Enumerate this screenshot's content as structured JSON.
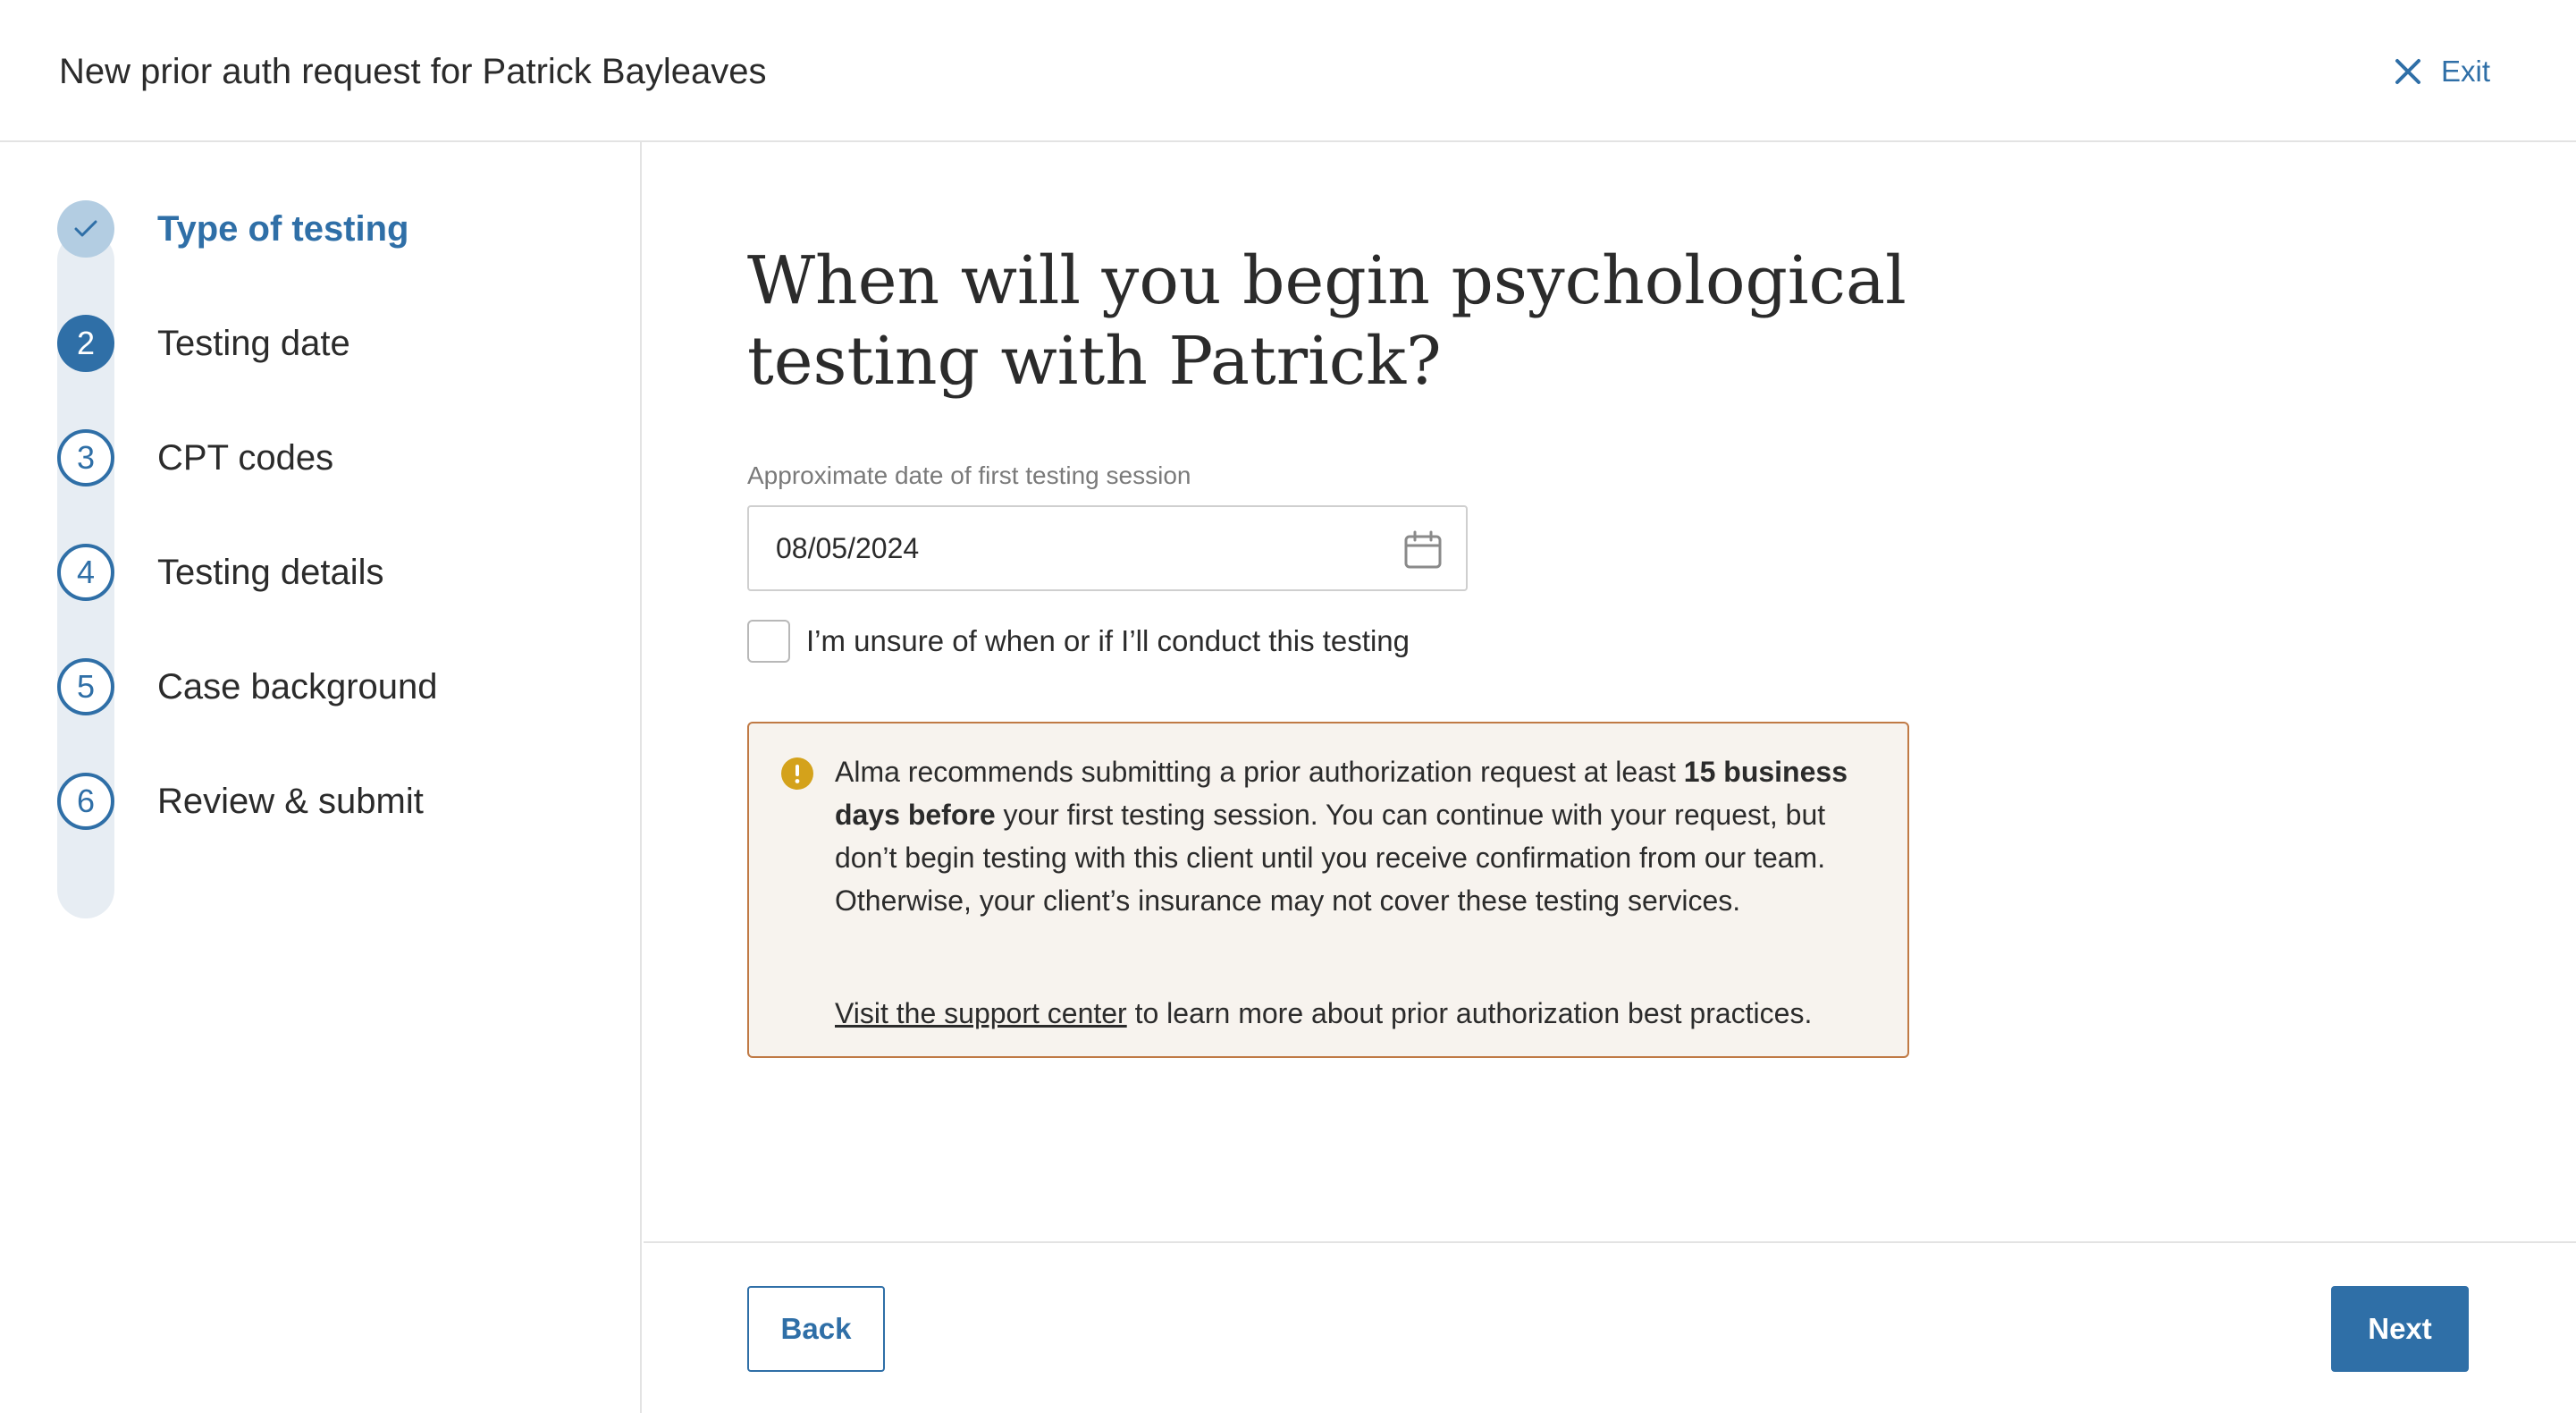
{
  "header": {
    "title": "New prior auth request for Patrick Bayleaves",
    "exit_label": "Exit"
  },
  "steps": [
    {
      "number": "",
      "label": "Type of testing",
      "status": "completed"
    },
    {
      "number": "2",
      "label": "Testing date",
      "status": "current"
    },
    {
      "number": "3",
      "label": "CPT codes",
      "status": "upcoming"
    },
    {
      "number": "4",
      "label": "Testing details",
      "status": "upcoming"
    },
    {
      "number": "5",
      "label": "Case background",
      "status": "upcoming"
    },
    {
      "number": "6",
      "label": "Review & submit",
      "status": "upcoming"
    }
  ],
  "main": {
    "question": "When will you begin psychological testing with Patrick?",
    "date_field": {
      "label": "Approximate date of first testing session",
      "value": "08/05/2024"
    },
    "checkbox": {
      "label": "I’m unsure of when or if I’ll conduct this testing",
      "checked": false
    },
    "alert": {
      "text_before": "Alma recommends submitting a prior authorization request at least ",
      "bold_text": "15 business days before",
      "text_after": " your first testing session. You can continue with your request, but don’t begin testing with this client until you receive confirmation from our team. Otherwise, your client’s insurance may not cover these testing services.",
      "link_text": "Visit the support center",
      "link_suffix": " to learn more about prior authorization best practices."
    }
  },
  "footer": {
    "back_label": "Back",
    "next_label": "Next"
  },
  "colors": {
    "accent": "#2f6fa7",
    "completed_step": "#b3cde2",
    "warning_icon": "#d4a21b",
    "alert_border": "#c07a45",
    "alert_background": "#f7f3ee"
  }
}
